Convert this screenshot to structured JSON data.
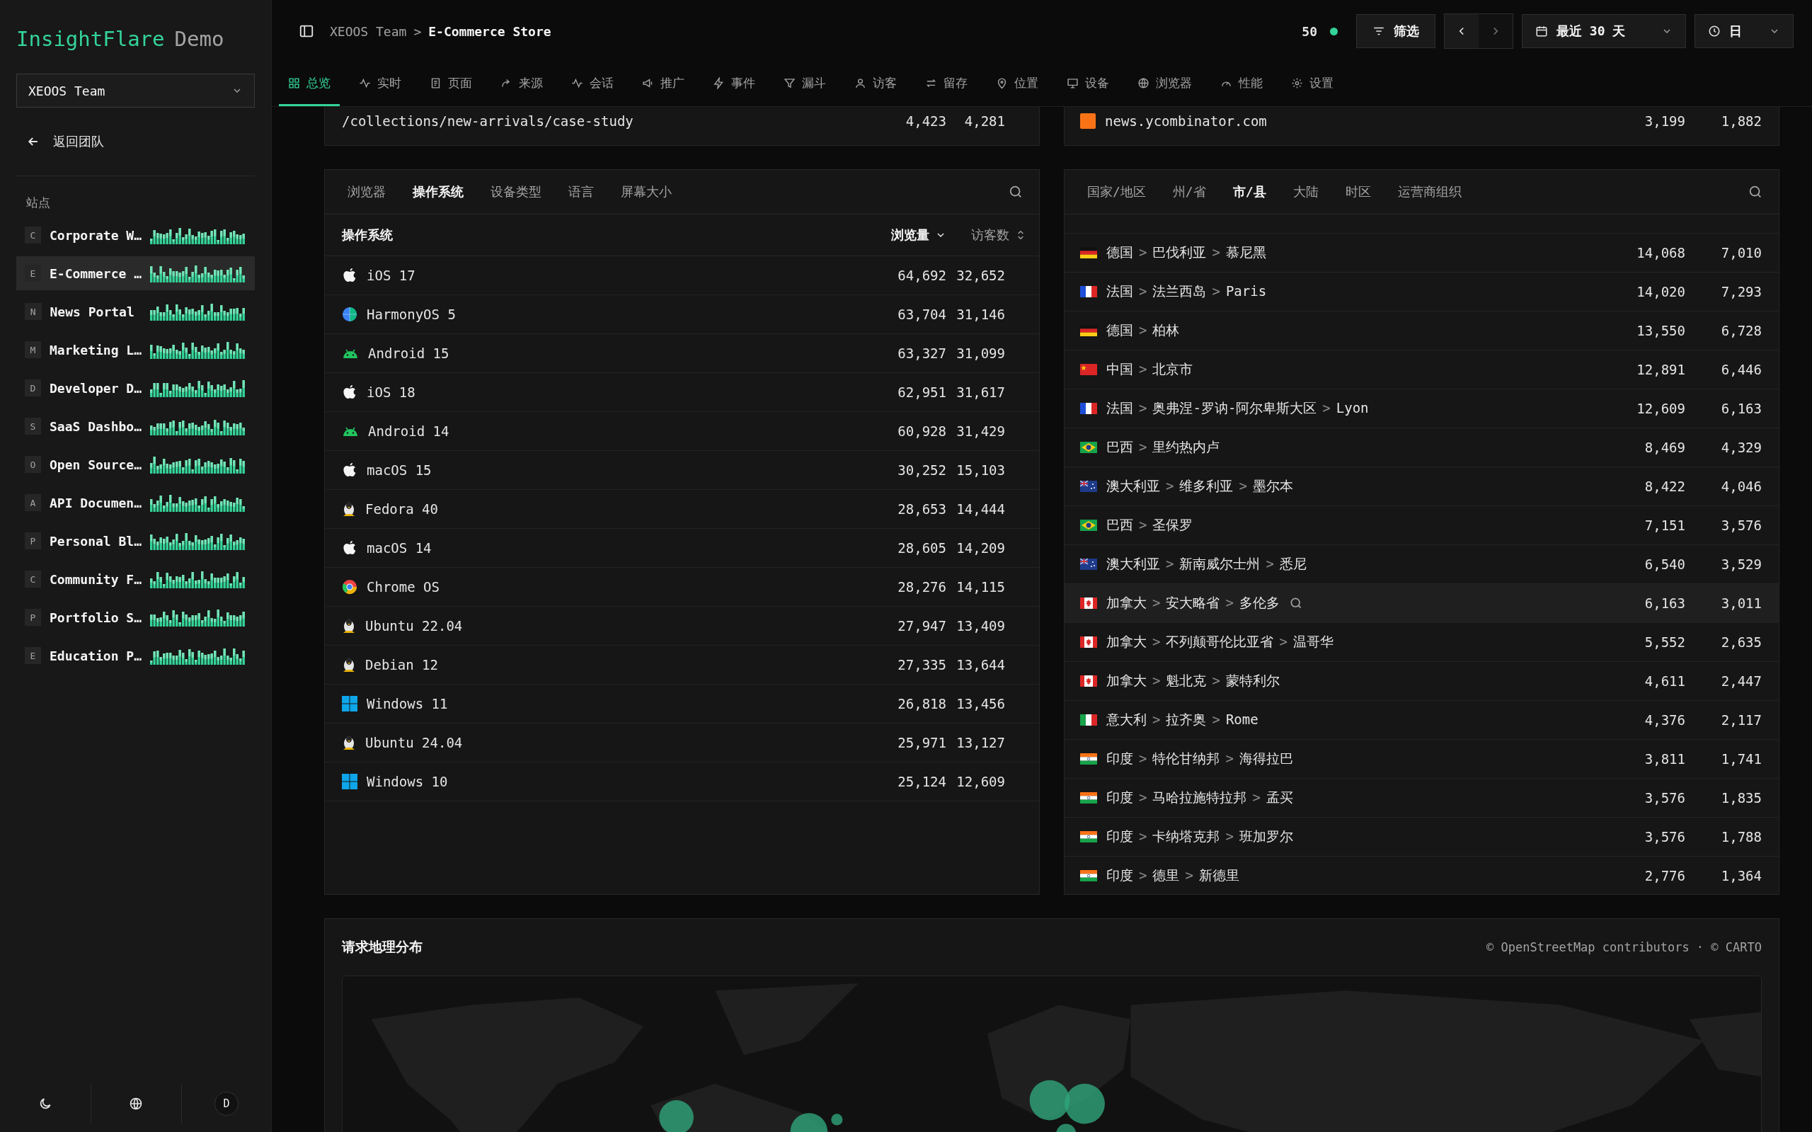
{
  "sidebar": {
    "brand": {
      "name": "InsightFlare",
      "suffix": "Demo"
    },
    "team_select": {
      "value": "XEOOS Team"
    },
    "back_link": "返回团队",
    "section_title": "站点",
    "sites": [
      {
        "letter": "C",
        "name": "Corporate W…",
        "selected": false
      },
      {
        "letter": "E",
        "name": "E-Commerce …",
        "selected": true
      },
      {
        "letter": "N",
        "name": "News Portal",
        "selected": false
      },
      {
        "letter": "M",
        "name": "Marketing L…",
        "selected": false
      },
      {
        "letter": "D",
        "name": "Developer D…",
        "selected": false
      },
      {
        "letter": "S",
        "name": "SaaS Dashbo…",
        "selected": false
      },
      {
        "letter": "O",
        "name": "Open Source…",
        "selected": false
      },
      {
        "letter": "A",
        "name": "API Documen…",
        "selected": false
      },
      {
        "letter": "P",
        "name": "Personal Bl…",
        "selected": false
      },
      {
        "letter": "C",
        "name": "Community F…",
        "selected": false
      },
      {
        "letter": "P",
        "name": "Portfolio S…",
        "selected": false
      },
      {
        "letter": "E",
        "name": "Education P…",
        "selected": false
      }
    ],
    "avatar": "D"
  },
  "header": {
    "breadcrumb": [
      "XEOOS Team",
      "E-Commerce Store"
    ],
    "separator": ">",
    "live_count": "50",
    "live": true,
    "filter_button": "筛选",
    "date_range": "最近 30 天",
    "granularity": "日"
  },
  "nav_tabs": [
    {
      "label": "总览",
      "selected": true
    },
    {
      "label": "实时",
      "selected": false
    },
    {
      "label": "页面",
      "selected": false
    },
    {
      "label": "来源",
      "selected": false
    },
    {
      "label": "会话",
      "selected": false
    },
    {
      "label": "推广",
      "selected": false
    },
    {
      "label": "事件",
      "selected": false
    },
    {
      "label": "漏斗",
      "selected": false
    },
    {
      "label": "访客",
      "selected": false
    },
    {
      "label": "留存",
      "selected": false
    },
    {
      "label": "位置",
      "selected": false
    },
    {
      "label": "设备",
      "selected": false
    },
    {
      "label": "浏览器",
      "selected": false
    },
    {
      "label": "性能",
      "selected": false
    },
    {
      "label": "设置",
      "selected": false
    }
  ],
  "pages_card": {
    "rows": [
      {
        "path": "/collections/new-arrivals/case-study",
        "views": "4,423",
        "visitors": "4,281"
      }
    ]
  },
  "referrers_card": {
    "rows": [
      {
        "kind": "favicon",
        "name": "news.ycombinator.com",
        "views": "3,199",
        "visitors": "1,882"
      }
    ]
  },
  "os_card": {
    "tabs": [
      {
        "label": "浏览器",
        "selected": false
      },
      {
        "label": "操作系统",
        "selected": true
      },
      {
        "label": "设备类型",
        "selected": false
      },
      {
        "label": "语言",
        "selected": false
      },
      {
        "label": "屏幕大小",
        "selected": false
      }
    ],
    "columns": [
      {
        "label": "操作系统",
        "kind": "plain"
      },
      {
        "label": "浏览量",
        "kind": "sortable",
        "sorted": true
      },
      {
        "label": "访客数",
        "kind": "sortable",
        "sorted": false
      }
    ],
    "rows": [
      {
        "kind": "apple",
        "name": "iOS 17",
        "views": "64,692",
        "visitors": "32,652"
      },
      {
        "kind": "harmony",
        "name": "HarmonyOS 5",
        "views": "63,704",
        "visitors": "31,146"
      },
      {
        "kind": "android",
        "name": "Android 15",
        "views": "63,327",
        "visitors": "31,099"
      },
      {
        "kind": "apple",
        "name": "iOS 18",
        "views": "62,951",
        "visitors": "31,617"
      },
      {
        "kind": "android",
        "name": "Android 14",
        "views": "60,928",
        "visitors": "31,429"
      },
      {
        "kind": "apple",
        "name": "macOS 15",
        "views": "30,252",
        "visitors": "15,103"
      },
      {
        "kind": "linux",
        "name": "Fedora 40",
        "views": "28,653",
        "visitors": "14,444"
      },
      {
        "kind": "apple",
        "name": "macOS 14",
        "views": "28,605",
        "visitors": "14,209"
      },
      {
        "kind": "chrome",
        "name": "Chrome OS",
        "views": "28,276",
        "visitors": "14,115"
      },
      {
        "kind": "linux",
        "name": "Ubuntu 22.04",
        "views": "27,947",
        "visitors": "13,409"
      },
      {
        "kind": "linux",
        "name": "Debian 12",
        "views": "27,335",
        "visitors": "13,644"
      },
      {
        "kind": "windows",
        "name": "Windows 11",
        "views": "26,818",
        "visitors": "13,456"
      },
      {
        "kind": "linux",
        "name": "Ubuntu 24.04",
        "views": "25,971",
        "visitors": "13,127"
      },
      {
        "kind": "windows",
        "name": "Windows 10",
        "views": "25,124",
        "visitors": "12,609"
      }
    ]
  },
  "geo_card": {
    "tabs": [
      {
        "label": "国家/地区",
        "selected": false
      },
      {
        "label": "州/省",
        "selected": false
      },
      {
        "label": "市/县",
        "selected": true
      },
      {
        "label": "大陆",
        "selected": false
      },
      {
        "label": "时区",
        "selected": false
      },
      {
        "label": "运营商组织",
        "selected": false
      }
    ],
    "separator": ">",
    "rows": [
      {
        "kind": "de",
        "path": [
          "德国",
          "巴伐利亚",
          "慕尼黑"
        ],
        "views": "14,068",
        "visitors": "7,010",
        "hovered": false
      },
      {
        "kind": "fr",
        "path": [
          "法国",
          "法兰西岛",
          "Paris"
        ],
        "views": "14,020",
        "visitors": "7,293",
        "hovered": false
      },
      {
        "kind": "de",
        "path": [
          "德国",
          "柏林"
        ],
        "views": "13,550",
        "visitors": "6,728",
        "hovered": false
      },
      {
        "kind": "cn",
        "path": [
          "中国",
          "北京市"
        ],
        "views": "12,891",
        "visitors": "6,446",
        "hovered": false
      },
      {
        "kind": "fr",
        "path": [
          "法国",
          "奥弗涅-罗讷-阿尔卑斯大区",
          "Lyon"
        ],
        "views": "12,609",
        "visitors": "6,163",
        "hovered": false
      },
      {
        "kind": "br",
        "path": [
          "巴西",
          "里约热内卢"
        ],
        "views": "8,469",
        "visitors": "4,329",
        "hovered": false
      },
      {
        "kind": "au",
        "path": [
          "澳大利亚",
          "维多利亚",
          "墨尔本"
        ],
        "views": "8,422",
        "visitors": "4,046",
        "hovered": false
      },
      {
        "kind": "br",
        "path": [
          "巴西",
          "圣保罗"
        ],
        "views": "7,151",
        "visitors": "3,576",
        "hovered": false
      },
      {
        "kind": "au",
        "path": [
          "澳大利亚",
          "新南威尔士州",
          "悉尼"
        ],
        "views": "6,540",
        "visitors": "3,529",
        "hovered": false
      },
      {
        "kind": "ca",
        "path": [
          "加拿大",
          "安大略省",
          "多伦多"
        ],
        "views": "6,163",
        "visitors": "3,011",
        "hovered": true
      },
      {
        "kind": "ca",
        "path": [
          "加拿大",
          "不列颠哥伦比亚省",
          "温哥华"
        ],
        "views": "5,552",
        "visitors": "2,635",
        "hovered": false
      },
      {
        "kind": "ca",
        "path": [
          "加拿大",
          "魁北克",
          "蒙特利尔"
        ],
        "views": "4,611",
        "visitors": "2,447",
        "hovered": false
      },
      {
        "kind": "it",
        "path": [
          "意大利",
          "拉齐奥",
          "Rome"
        ],
        "views": "4,376",
        "visitors": "2,117",
        "hovered": false
      },
      {
        "kind": "in",
        "path": [
          "印度",
          "特伦甘纳邦",
          "海得拉巴"
        ],
        "views": "3,811",
        "visitors": "1,741",
        "hovered": false
      },
      {
        "kind": "in",
        "path": [
          "印度",
          "马哈拉施特拉邦",
          "孟买"
        ],
        "views": "3,576",
        "visitors": "1,835",
        "hovered": false
      },
      {
        "kind": "in",
        "path": [
          "印度",
          "卡纳塔克邦",
          "班加罗尔"
        ],
        "views": "3,576",
        "visitors": "1,788",
        "hovered": false
      },
      {
        "kind": "in",
        "path": [
          "印度",
          "德里",
          "新德里"
        ],
        "views": "2,776",
        "visitors": "1,364",
        "hovered": false
      }
    ]
  },
  "map_card": {
    "title": "请求地理分布",
    "attribution": "© OpenStreetMap contributors · © CARTO"
  }
}
